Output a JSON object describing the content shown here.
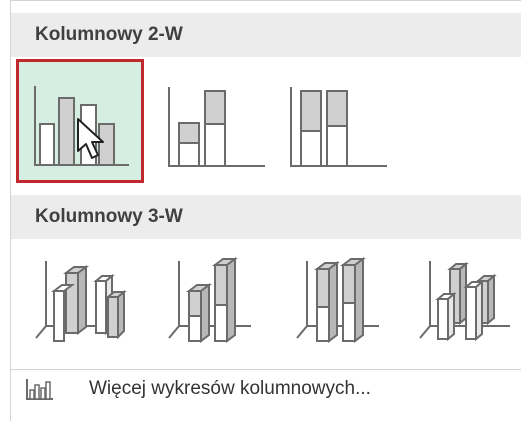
{
  "sections": [
    {
      "title": "Kolumnowy 2-W"
    },
    {
      "title": "Kolumnowy 3-W"
    }
  ],
  "more_charts_label": "Więcej wykresów kolumnowych...",
  "colors": {
    "selected_fill": "#d6eee1",
    "selected_border": "#c0282e",
    "header_bg": "#ececec",
    "bar_fill": "#d0d0d0",
    "outline": "#6b6b6b"
  },
  "icons": {
    "tiles_2d": [
      "clustered-column-icon",
      "stacked-column-icon",
      "100-percent-stacked-column-icon"
    ],
    "tiles_3d": [
      "3d-clustered-column-icon",
      "3d-stacked-column-icon",
      "3d-100-percent-stacked-column-icon",
      "3d-column-icon"
    ],
    "more": "column-chart-small-icon",
    "cursor": "mouse-pointer-icon"
  }
}
